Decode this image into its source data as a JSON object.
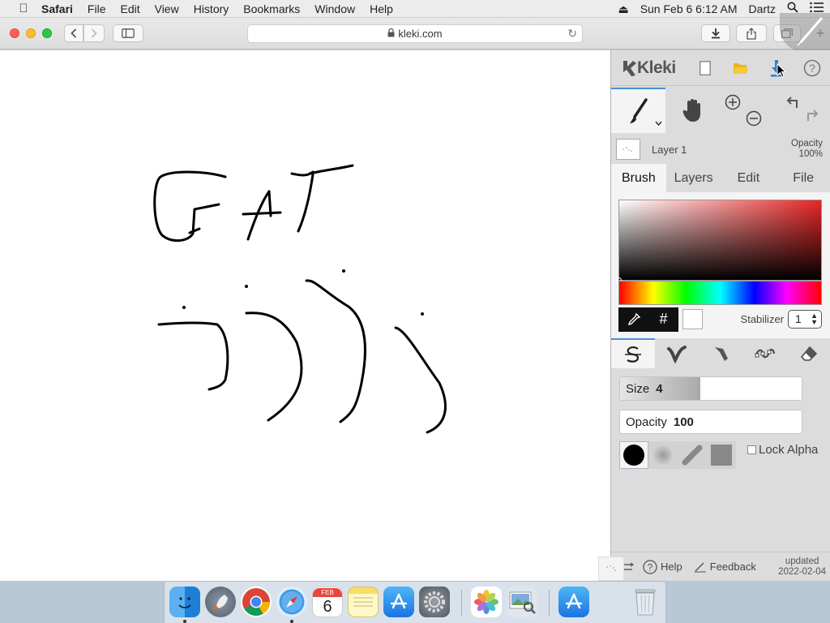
{
  "menubar": {
    "app": "Safari",
    "items": [
      "File",
      "Edit",
      "View",
      "History",
      "Bookmarks",
      "Window",
      "Help"
    ],
    "clock": "Sun Feb 6  6:12 AM",
    "user": "Dartz"
  },
  "browser": {
    "url": "kleki.com"
  },
  "kleki": {
    "logo": "Kleki",
    "layer": {
      "name": "Layer 1",
      "opacity_label": "Opacity",
      "opacity_value": "100%"
    },
    "tabs": [
      "Brush",
      "Layers",
      "Edit",
      "File"
    ],
    "active_tab": "Brush",
    "color": {
      "hex_button": "#",
      "stabilizer_label": "Stabilizer",
      "stabilizer_value": "1"
    },
    "brush": {
      "size_label": "Size",
      "size_value": "4",
      "size_fraction": 0.44,
      "opacity_label": "Opacity",
      "opacity_value": "100",
      "opacity_fraction": 0,
      "lock_alpha_label": "Lock Alpha"
    },
    "footer": {
      "help_label": "Help",
      "feedback_label": "Feedback",
      "updated_label": "updated",
      "updated_date": "2022-02-04"
    }
  },
  "dock": {
    "calendar_month": "FEB",
    "calendar_day": "6"
  },
  "colors": {
    "accent": "#4b8fd9",
    "ink": "#000000",
    "sv_hue": "#e82626"
  }
}
